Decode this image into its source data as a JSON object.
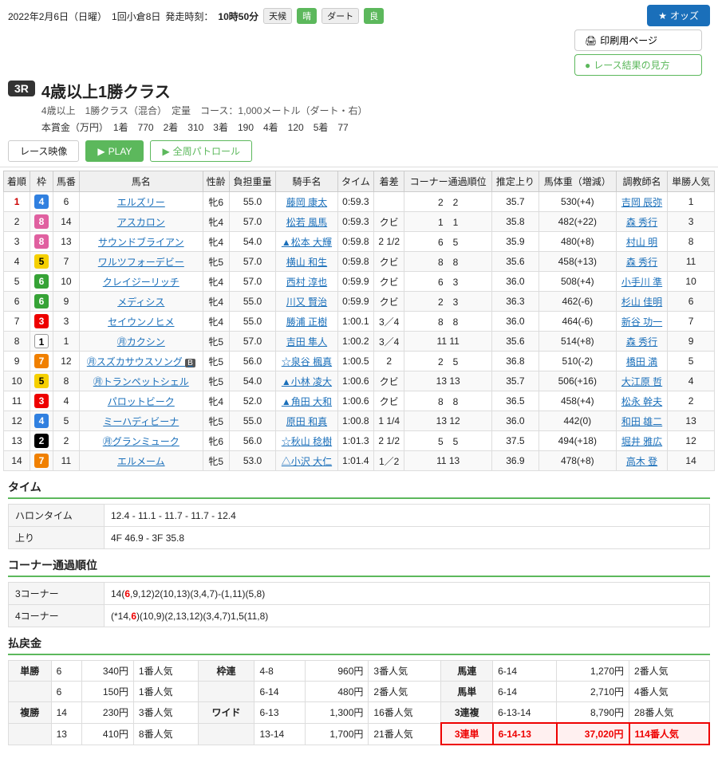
{
  "header": {
    "date": "2022年2月6日（日曜）",
    "race_num_label": "1回小倉8日",
    "start_time_label": "発走時刻：",
    "start_time": "10時50分",
    "conditions": [
      "天候",
      "晴",
      "ダート",
      "良"
    ],
    "odds_btn": "オッズ",
    "print_btn": "印刷用ページ",
    "result_btn": "レース結果の見方"
  },
  "race": {
    "num": "3R",
    "title": "4歳以上1勝クラス",
    "subtitle": "4歳以上　1勝クラス（混合）　定量　コース：1,000メートル（ダート・右）",
    "prize_label": "本賞金（万円）",
    "prizes": [
      {
        "rank": "1着",
        "amount": "770"
      },
      {
        "rank": "2着",
        "amount": "310"
      },
      {
        "rank": "3着",
        "amount": "190"
      },
      {
        "rank": "4着",
        "amount": "120"
      },
      {
        "rank": "5着",
        "amount": "77"
      }
    ]
  },
  "tabs": {
    "movie": "レース映像",
    "play": "PLAY",
    "patrol": "全周パトロール"
  },
  "table": {
    "headers": [
      "着順",
      "枠",
      "馬番",
      "馬名",
      "性齢",
      "負担重量",
      "騎手名",
      "タイム",
      "着差",
      "コーナー通過順位",
      "推定上り",
      "馬体重（増減）",
      "調教師名",
      "単勝人気"
    ],
    "rows": [
      {
        "rank": "1",
        "waku": "4",
        "uma": "6",
        "name": "エルズリー",
        "sex": "牝6",
        "weight": "55.0",
        "jockey": "藤岡 康太",
        "time": "0:59.3",
        "diff": "",
        "corner": "2　2",
        "agari": "35.7",
        "bodyweight": "530(+4)",
        "trainer": "吉岡 辰弥",
        "popular": "1"
      },
      {
        "rank": "2",
        "waku": "8",
        "uma": "14",
        "name": "アスカロン",
        "sex": "牝4",
        "weight": "57.0",
        "jockey": "松若 風馬",
        "time": "0:59.3",
        "diff": "クビ",
        "corner": "1　1",
        "agari": "35.8",
        "bodyweight": "482(+22)",
        "trainer": "森 秀行",
        "popular": "3"
      },
      {
        "rank": "3",
        "waku": "8",
        "uma": "13",
        "name": "サウンドブライアン",
        "sex": "牝4",
        "weight": "54.0",
        "jockey": "▲松本 大輝",
        "time": "0:59.8",
        "diff": "2 1/2",
        "corner": "6　5",
        "agari": "35.9",
        "bodyweight": "480(+8)",
        "trainer": "村山 明",
        "popular": "8"
      },
      {
        "rank": "4",
        "waku": "5",
        "uma": "7",
        "name": "ワルツフォーデビー",
        "sex": "牝5",
        "weight": "57.0",
        "jockey": "横山 和生",
        "time": "0:59.8",
        "diff": "クビ",
        "corner": "8　8",
        "agari": "35.6",
        "bodyweight": "458(+13)",
        "trainer": "森 秀行",
        "popular": "11"
      },
      {
        "rank": "5",
        "waku": "6",
        "uma": "10",
        "name": "クレイジーリッチ",
        "sex": "牝4",
        "weight": "57.0",
        "jockey": "西村 淳也",
        "time": "0:59.9",
        "diff": "クビ",
        "corner": "6　3",
        "agari": "36.0",
        "bodyweight": "508(+4)",
        "trainer": "小手川 準",
        "popular": "10"
      },
      {
        "rank": "6",
        "waku": "6",
        "uma": "9",
        "name": "メディシス",
        "sex": "牝4",
        "weight": "55.0",
        "jockey": "川又 賢治",
        "time": "0:59.9",
        "diff": "クビ",
        "corner": "2　3",
        "agari": "36.3",
        "bodyweight": "462(-6)",
        "trainer": "杉山 佳明",
        "popular": "6"
      },
      {
        "rank": "7",
        "waku": "3",
        "uma": "3",
        "name": "セイウンノヒメ",
        "sex": "牝4",
        "weight": "55.0",
        "jockey": "勝浦 正樹",
        "time": "1:00.1",
        "diff": "3／4",
        "corner": "8　8",
        "agari": "36.0",
        "bodyweight": "464(-6)",
        "trainer": "新谷 功一",
        "popular": "7"
      },
      {
        "rank": "8",
        "waku": "1",
        "uma": "1",
        "name": "㊊カクシン",
        "sex": "牝5",
        "weight": "57.0",
        "jockey": "吉田 隼人",
        "time": "1:00.2",
        "diff": "3／4",
        "corner": "11 11",
        "agari": "35.6",
        "bodyweight": "514(+8)",
        "trainer": "森 秀行",
        "popular": "9"
      },
      {
        "rank": "9",
        "waku": "7",
        "uma": "12",
        "name": "㊊スズカサウスソング",
        "badge": "B",
        "sex": "牝5",
        "weight": "56.0",
        "jockey": "☆泉谷 楓真",
        "time": "1:00.5",
        "diff": "2",
        "corner": "2　5",
        "agari": "36.8",
        "bodyweight": "510(-2)",
        "trainer": "橋田 満",
        "popular": "5"
      },
      {
        "rank": "10",
        "waku": "5",
        "uma": "8",
        "name": "㊊トランペットシェル",
        "sex": "牝5",
        "weight": "54.0",
        "jockey": "▲小林 凌大",
        "time": "1:00.6",
        "diff": "クビ",
        "corner": "13 13",
        "agari": "35.7",
        "bodyweight": "506(+16)",
        "trainer": "大江原 哲",
        "popular": "4"
      },
      {
        "rank": "11",
        "waku": "3",
        "uma": "4",
        "name": "パロットビーク",
        "sex": "牝4",
        "weight": "52.0",
        "jockey": "▲角田 大和",
        "time": "1:00.6",
        "diff": "クビ",
        "corner": "8　8",
        "agari": "36.5",
        "bodyweight": "458(+4)",
        "trainer": "松永 幹夫",
        "popular": "2"
      },
      {
        "rank": "12",
        "waku": "4",
        "uma": "5",
        "name": "ミーハディビーナ",
        "sex": "牝5",
        "weight": "55.0",
        "jockey": "原田 和真",
        "time": "1:00.8",
        "diff": "1 1/4",
        "corner": "13 12",
        "agari": "36.0",
        "bodyweight": "442(0)",
        "trainer": "和田 雄二",
        "popular": "13"
      },
      {
        "rank": "13",
        "waku": "2",
        "uma": "2",
        "name": "㊊グランミューク",
        "sex": "牝6",
        "weight": "56.0",
        "jockey": "☆秋山 稔樹",
        "time": "1:01.3",
        "diff": "2 1/2",
        "corner": "5　5",
        "agari": "37.5",
        "bodyweight": "494(+18)",
        "trainer": "堀井 雅広",
        "popular": "12"
      },
      {
        "rank": "14",
        "waku": "7",
        "uma": "11",
        "name": "エルメーム",
        "sex": "牝5",
        "weight": "53.0",
        "jockey": "△小沢 大仁",
        "time": "1:01.4",
        "diff": "1／2",
        "corner": "11 13",
        "agari": "36.9",
        "bodyweight": "478(+8)",
        "trainer": "高木 登",
        "popular": "14"
      }
    ]
  },
  "time_section": {
    "title": "タイム",
    "rows": [
      {
        "label": "ハロンタイム",
        "value": "12.4 - 11.1 - 11.7 - 11.7 - 12.4"
      },
      {
        "label": "上り",
        "value": "4F 46.9 - 3F 35.8"
      }
    ]
  },
  "corner_section": {
    "title": "コーナー通過順位",
    "rows": [
      {
        "label": "3コーナー",
        "value": "14(6,9,12)2(10,13)(3,4,7)-(1,11)(5,8)",
        "highlight": "6"
      },
      {
        "label": "4コーナー",
        "value": "(*14,6)(10,9)(2,13,12)(3,4,7)1,5(11,8)",
        "highlight": "6"
      }
    ]
  },
  "payout_section": {
    "title": "払戻金",
    "rows": [
      {
        "type1": "単勝",
        "num1": "6",
        "pay1": "340円",
        "pop1": "1番人気",
        "type2": "枠連",
        "num2": "4-8",
        "pay2": "960円",
        "pop2": "3番人気",
        "type3": "馬連",
        "num3": "6-14",
        "pay3": "1,270円",
        "pop3": "2番人気"
      },
      {
        "type1": "",
        "num1": "6",
        "pay1": "150円",
        "pop1": "1番人気",
        "type2": "",
        "num2": "6-14",
        "pay2": "480円",
        "pop2": "2番人気",
        "type3": "馬単",
        "num3": "6-14",
        "pay3": "2,710円",
        "pop3": "4番人気"
      },
      {
        "type1": "複勝",
        "num1": "14",
        "pay1": "230円",
        "pop1": "3番人気",
        "type2": "ワイド",
        "num2": "6-13",
        "pay2": "1,300円",
        "pop2": "16番人気",
        "type3": "3連複",
        "num3": "6-13-14",
        "pay3": "8,790円",
        "pop3": "28番人気"
      },
      {
        "type1": "",
        "num1": "13",
        "pay1": "410円",
        "pop1": "8番人気",
        "type2": "",
        "num2": "13-14",
        "pay2": "1,700円",
        "pop2": "21番人気",
        "type3": "3連単",
        "num3": "6-14-13",
        "pay3": "37,020円",
        "pop3": "114番人気",
        "highlight": true
      }
    ]
  }
}
